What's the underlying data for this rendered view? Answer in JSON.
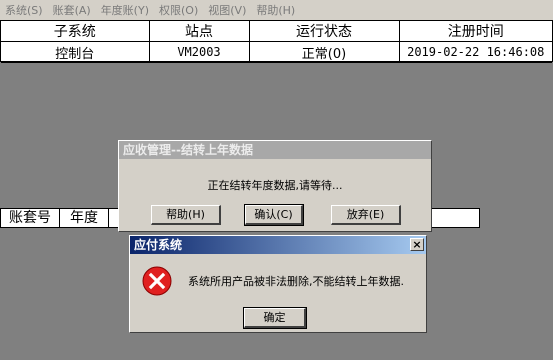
{
  "menu": [
    "系统(S)",
    "账套(A)",
    "年度账(Y)",
    "权限(O)",
    "视图(V)",
    "帮助(H)"
  ],
  "top_table": {
    "headers": [
      "子系统",
      "站点",
      "运行状态",
      "注册时间"
    ],
    "row": [
      "控制台",
      "VM2003",
      "正常(0)",
      "2019-02-22 16:46:08"
    ]
  },
  "bottom_table": {
    "headers": [
      "账套号",
      "年度"
    ]
  },
  "dialog_progress": {
    "title": "应收管理--结转上年数据",
    "message": "正在结转年度数据,请等待...",
    "buttons": {
      "help": "帮助(H)",
      "ok": "确认(C)",
      "give_up": "放弃(E)"
    }
  },
  "dialog_error": {
    "title": "应付系统",
    "message": "系统所用产品被非法删除,不能结转上年数据.",
    "confirm": "确定",
    "close": "×",
    "icon": "error-icon",
    "icon_color": "#e02020"
  }
}
